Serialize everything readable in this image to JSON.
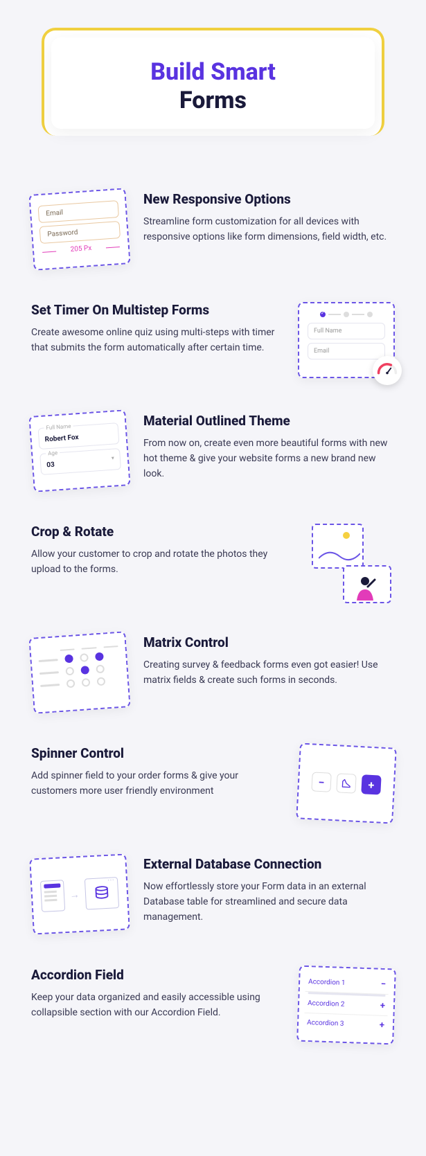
{
  "header": {
    "line1": "Build Smart",
    "line2": "Forms"
  },
  "features": [
    {
      "title": "New Responsive Options",
      "desc": "Streamline form customization for all devices with responsive options like form dimensions, field width, etc.",
      "il": {
        "email": "Email",
        "password": "Password",
        "dim": "205 Px"
      }
    },
    {
      "title": "Set Timer On Multistep Forms",
      "desc": "Create awesome online quiz using multi-steps with timer that submits the form automatically after certain time.",
      "il": {
        "fullname": "Full Name",
        "email": "Email"
      }
    },
    {
      "title": "Material Outlined Theme",
      "desc": "From now on, create even more beautiful forms with new hot theme & give your website forms a new brand new look.",
      "il": {
        "fnLabel": "Full Name",
        "fnValue": "Robert Fox",
        "ageLabel": "Age",
        "ageValue": "03"
      }
    },
    {
      "title": "Crop & Rotate",
      "desc": "Allow your customer to crop and rotate the photos they upload to the forms."
    },
    {
      "title": "Matrix Control",
      "desc": "Creating survey & feedback forms even got easier! Use matrix fields & create such forms in seconds."
    },
    {
      "title": "Spinner Control",
      "desc": "Add spinner field to your order forms & give your customers more user friendly environment"
    },
    {
      "title": "External Database Connection",
      "desc": "Now effortlessly store your Form data in an external Database table for streamlined and secure data management."
    },
    {
      "title": "Accordion Field",
      "desc": "Keep your data organized and easily accessible using collapsible section with our Accordion Field.",
      "il": {
        "a1": "Accordion 1",
        "a2": "Accordion 2",
        "a3": "Accordion 3"
      }
    }
  ]
}
